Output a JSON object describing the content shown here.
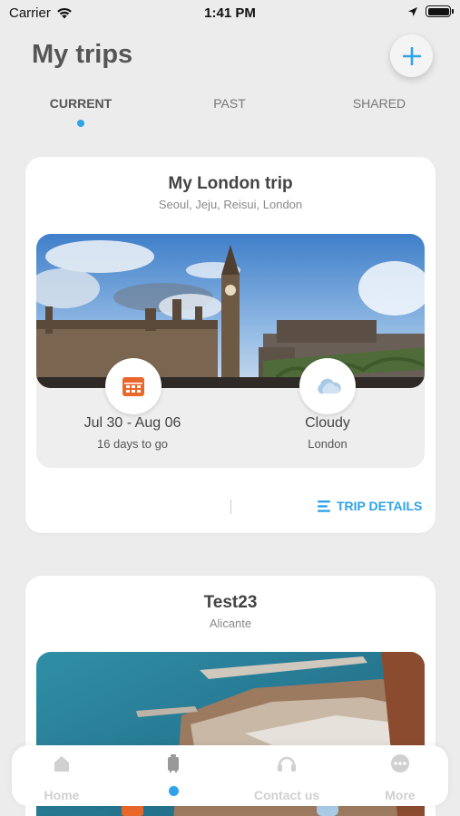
{
  "status_bar": {
    "carrier": "Carrier",
    "time": "1:41 PM"
  },
  "header": {
    "title": "My trips",
    "add_icon": "plus-icon"
  },
  "tabs": [
    {
      "label": "CURRENT",
      "active": true
    },
    {
      "label": "PAST",
      "active": false
    },
    {
      "label": "SHARED",
      "active": false
    }
  ],
  "trips": [
    {
      "name": "My London trip",
      "places": "Seoul, Jeju, Reisui, London",
      "image": "london-skyline-photo",
      "dates": "Jul 30 - Aug 06",
      "countdown": "16 days to go",
      "weather": "Cloudy",
      "weather_location": "London",
      "details_label": "TRIP DETAILS"
    },
    {
      "name": "Test23",
      "places": "Alicante",
      "image": "alicante-harbor-photo"
    }
  ],
  "bottom_nav": [
    {
      "label": "Home",
      "icon": "home-icon"
    },
    {
      "label": "",
      "icon": "luggage-icon",
      "active": true
    },
    {
      "label": "Contact us",
      "icon": "headset-icon"
    },
    {
      "label": "More",
      "icon": "more-icon"
    }
  ],
  "colors": {
    "accent": "#2ea3e9",
    "calendar": "#e8672a",
    "background": "#ececec"
  }
}
